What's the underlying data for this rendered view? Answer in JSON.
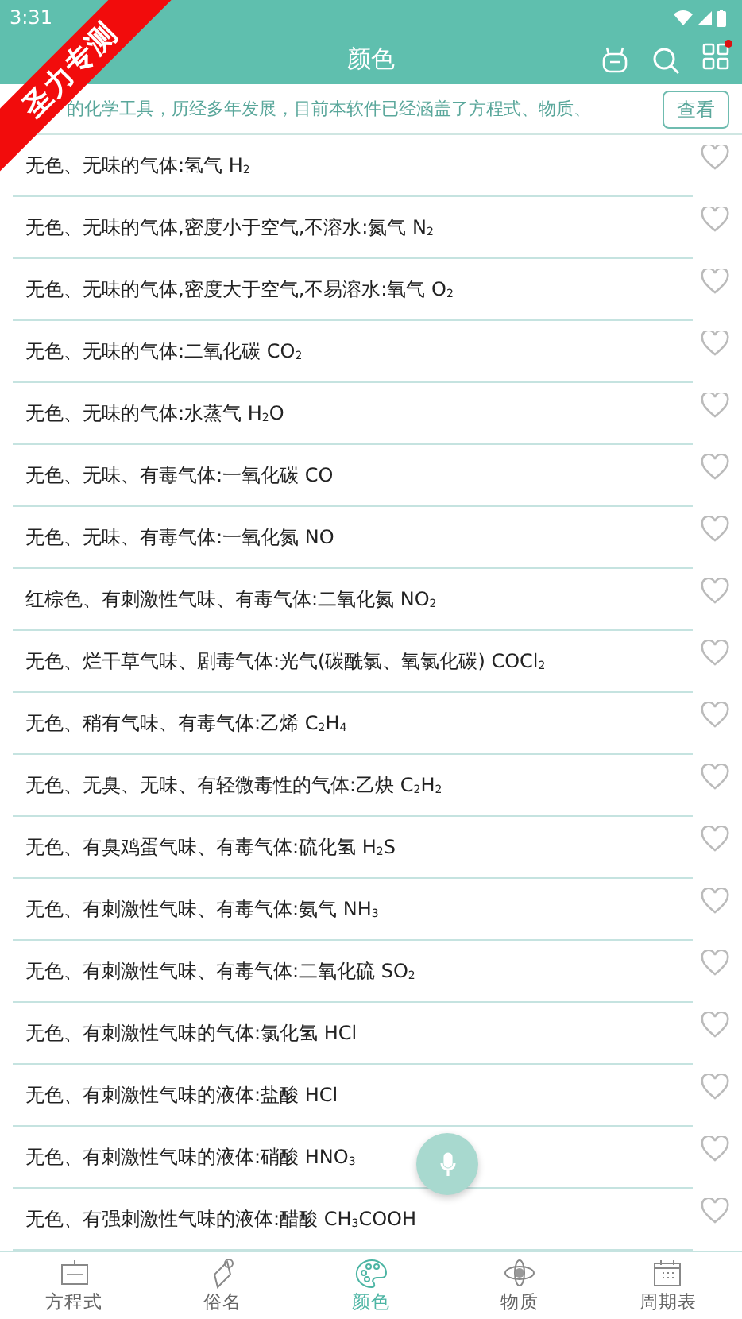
{
  "status_bar": {
    "time": "3:31"
  },
  "ribbon": {
    "text": "圣力专测"
  },
  "toolbar": {
    "title": "颜色",
    "notification_dot": true
  },
  "notice": {
    "text": "的化学工具，历经多年发展，目前本软件已经涵盖了方程式、物质、",
    "button": "查看"
  },
  "items": [
    {
      "text": "无色、无味的气体:氢气 H$_{2}$",
      "favorite": false
    },
    {
      "text": "无色、无味的气体,密度小于空气,不溶水:氮气 N$_{2}$",
      "favorite": false
    },
    {
      "text": "无色、无味的气体,密度大于空气,不易溶水:氧气 O$_{2}$",
      "favorite": false
    },
    {
      "text": "无色、无味的气体:二氧化碳 CO$_{2}$",
      "favorite": false
    },
    {
      "text": "无色、无味的气体:水蒸气 H$_{2}$O",
      "favorite": false
    },
    {
      "text": "无色、无味、有毒气体:一氧化碳 CO",
      "favorite": false
    },
    {
      "text": "无色、无味、有毒气体:一氧化氮 NO",
      "favorite": false
    },
    {
      "text": "红棕色、有刺激性气味、有毒气体:二氧化氮 NO$_{2}$",
      "favorite": false
    },
    {
      "text": "无色、烂干草气味、剧毒气体:光气(碳酰氯、氧氯化碳) COCl$_{2}$",
      "favorite": false
    },
    {
      "text": "无色、稍有气味、有毒气体:乙烯 C$_{2}$H$_{4}$",
      "favorite": false
    },
    {
      "text": "无色、无臭、无味、有轻微毒性的气体:乙炔 C$_{2}$H$_{2}$",
      "favorite": false
    },
    {
      "text": "无色、有臭鸡蛋气味、有毒气体:硫化氢 H$_{2}$S",
      "favorite": false
    },
    {
      "text": "无色、有刺激性气味、有毒气体:氨气 NH$_{3}$",
      "favorite": false
    },
    {
      "text": "无色、有刺激性气味、有毒气体:二氧化硫 SO$_{2}$",
      "favorite": false
    },
    {
      "text": "无色、有刺激性气味的气体:氯化氢 HCl",
      "favorite": false
    },
    {
      "text": "无色、有刺激性气味的液体:盐酸 HCl",
      "favorite": false
    },
    {
      "text": "无色、有刺激性气味的液体:硝酸 HNO$_{3}$",
      "favorite": false
    },
    {
      "text": "无色、有强刺激性气味的液体:醋酸 CH$_{3}$COOH",
      "favorite": false
    }
  ],
  "nav": [
    {
      "label": "方程式",
      "kind": "board",
      "selected": false
    },
    {
      "label": "俗名",
      "kind": "tag",
      "selected": false
    },
    {
      "label": "颜色",
      "kind": "palette",
      "selected": true
    },
    {
      "label": "物质",
      "kind": "atom",
      "selected": false
    },
    {
      "label": "周期表",
      "kind": "calendar",
      "selected": false
    }
  ]
}
